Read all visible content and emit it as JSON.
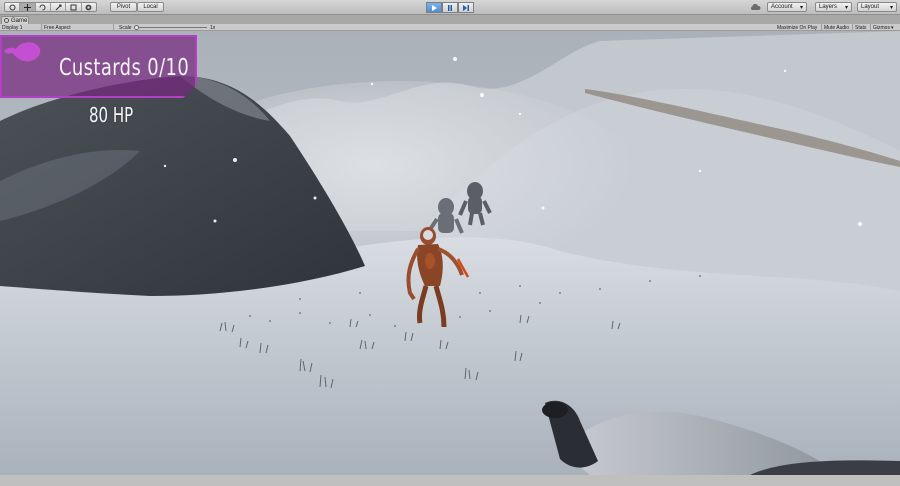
{
  "toolbar": {
    "tools": [
      "hand-tool",
      "move-tool",
      "rotate-tool",
      "scale-tool",
      "rect-tool",
      "transform-tool"
    ],
    "pivot_label": "Pivot",
    "local_label": "Local",
    "account_label": "Account",
    "layers_label": "Layers",
    "layout_label": "Layout"
  },
  "tab": {
    "title": "Game"
  },
  "viewbar": {
    "display": "Display 1",
    "aspect": "Free Aspect",
    "scale_label": "Scale",
    "scale_value": "1x",
    "maximize_label": "Maximize On Play",
    "mute_label": "Mute Audio",
    "stats_label": "Stats",
    "gizmos_label": "Gizmos"
  },
  "hud": {
    "custards_label": "Custards 0/10",
    "hp_label": "80 HP"
  },
  "colors": {
    "hud_purple": "#762880",
    "hud_border": "#b33fc5",
    "play_active": "#4f8fd0"
  }
}
